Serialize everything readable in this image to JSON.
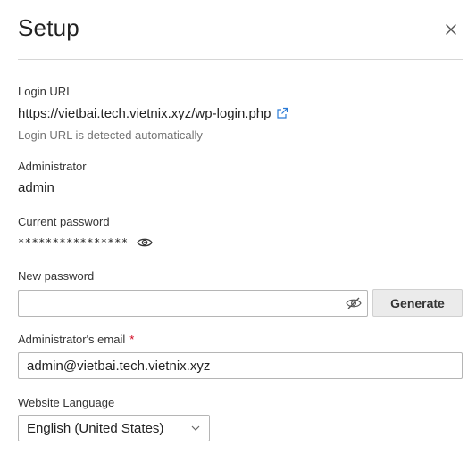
{
  "dialog": {
    "title": "Setup",
    "close_icon": "close-icon"
  },
  "login_url": {
    "label": "Login URL",
    "value": "https://vietbai.tech.vietnix.xyz/wp-login.php",
    "icon": "external-link-icon",
    "hint": "Login URL is detected automatically"
  },
  "administrator": {
    "label": "Administrator",
    "value": "admin"
  },
  "current_password": {
    "label": "Current password",
    "masked_value": "****************",
    "icon": "eye-icon"
  },
  "new_password": {
    "label": "New password",
    "value": "",
    "placeholder": "",
    "icon": "eye-slash-icon",
    "generate_label": "Generate"
  },
  "admin_email": {
    "label": "Administrator's email",
    "required_marker": "*",
    "value": "admin@vietbai.tech.vietnix.xyz"
  },
  "website_language": {
    "label": "Website Language",
    "selected": "English (United States)",
    "icon": "chevron-down-icon"
  },
  "colors": {
    "required": "#d0021b",
    "link_icon": "#2b7bd6",
    "divider": "#d6d6d6",
    "button_bg": "#ebebeb"
  }
}
